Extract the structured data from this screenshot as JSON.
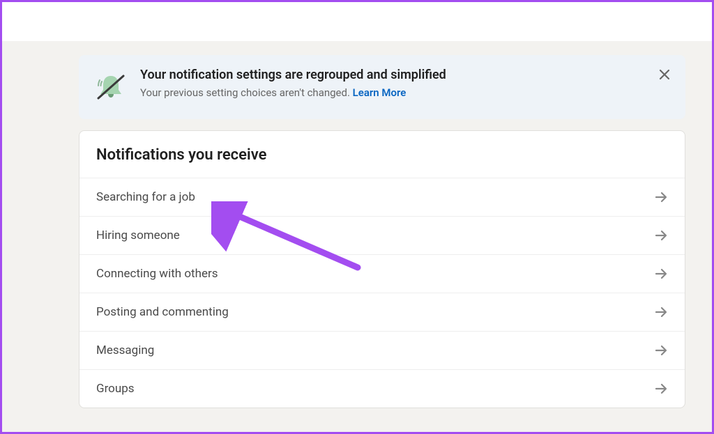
{
  "banner": {
    "title": "Your notification settings are regrouped and simplified",
    "subtitle": "Your previous setting choices aren't changed. ",
    "link_text": "Learn More"
  },
  "main": {
    "title": "Notifications you receive",
    "items": [
      {
        "label": "Searching for a job"
      },
      {
        "label": "Hiring someone"
      },
      {
        "label": "Connecting with others"
      },
      {
        "label": "Posting and commenting"
      },
      {
        "label": "Messaging"
      },
      {
        "label": "Groups"
      }
    ]
  }
}
